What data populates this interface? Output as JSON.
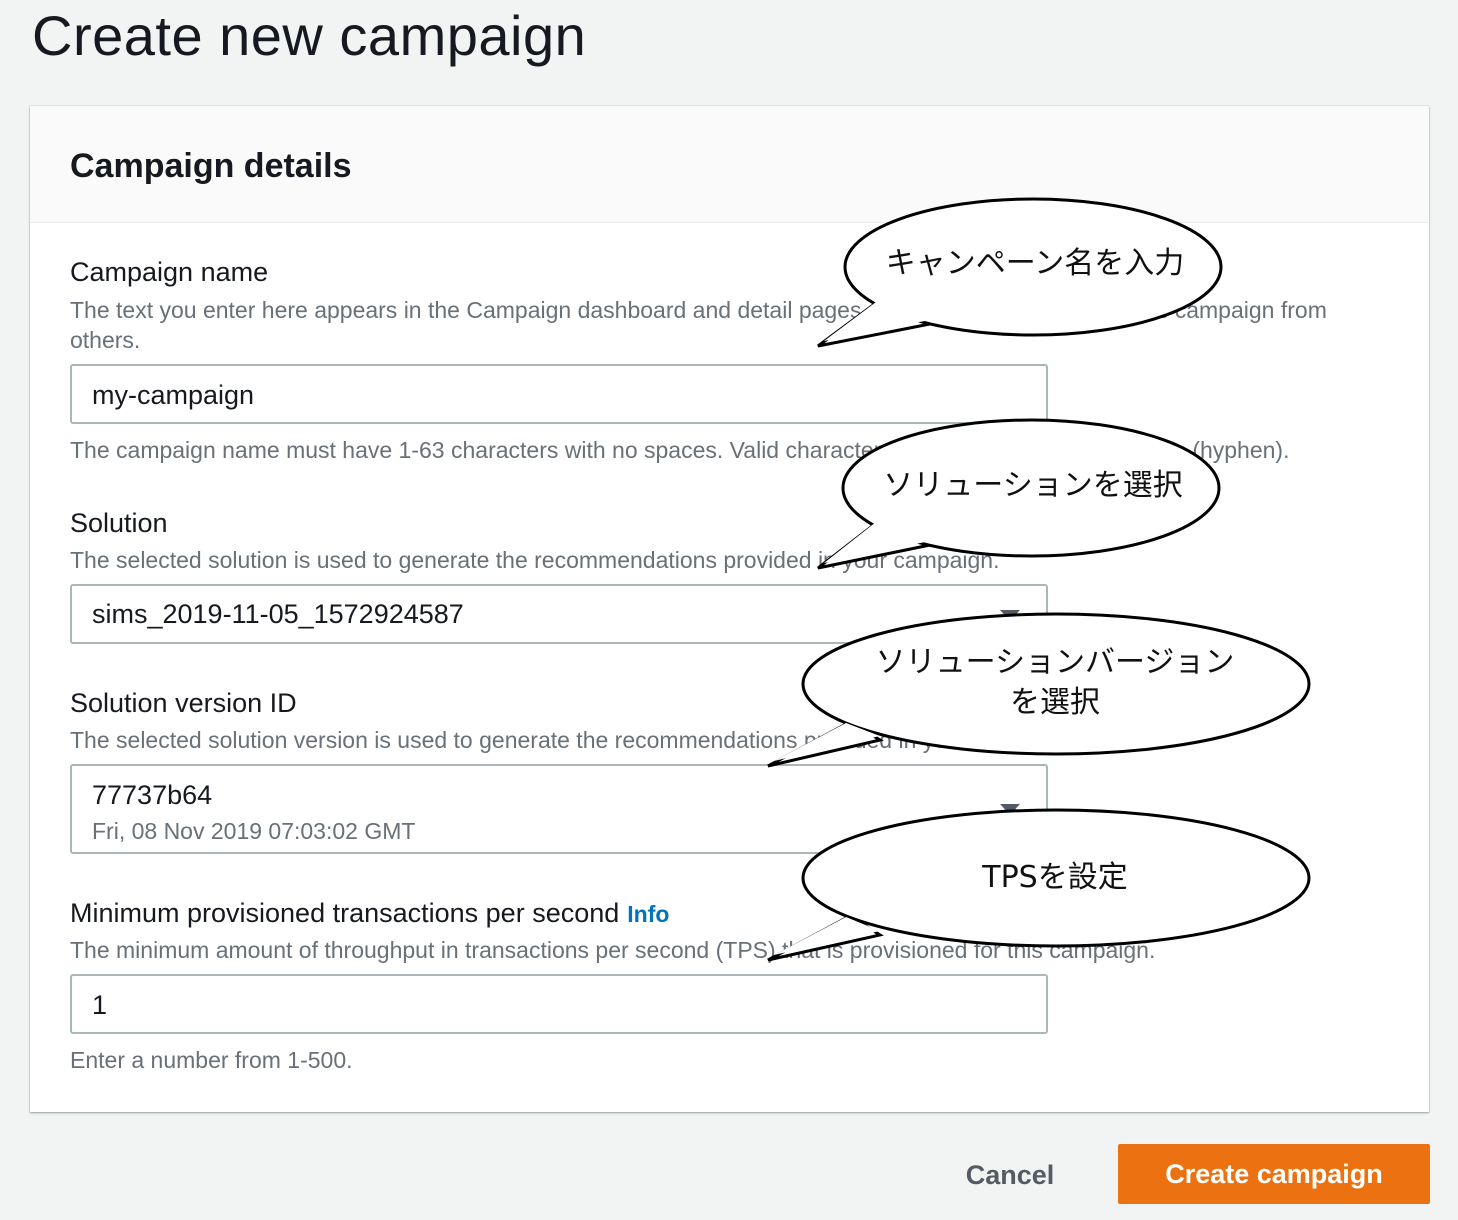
{
  "page": {
    "title": "Create new campaign"
  },
  "panel": {
    "title": "Campaign details"
  },
  "fields": {
    "campaign_name": {
      "label": "Campaign name",
      "description": "The text you enter here appears in the Campaign dashboard and detail pages and helps you distinguish this campaign from others.",
      "value": "my-campaign",
      "constraint": "The campaign name must have 1-63 characters with no spaces. Valid characters: a-z, A-Z, 0-9, and _ . @ % - (hyphen)."
    },
    "solution": {
      "label": "Solution",
      "description": "The selected solution is used to generate the recommendations provided in your campaign.",
      "selected": "sims_2019-11-05_1572924587"
    },
    "solution_version": {
      "label": "Solution version ID",
      "description": "The selected solution version is used to generate the recommendations provided in your campaign.",
      "selected": "77737b64",
      "selected_sub": "Fri, 08 Nov 2019 07:03:02 GMT"
    },
    "min_tps": {
      "label": "Minimum provisioned transactions per second",
      "info_link": "Info",
      "description": "The minimum amount of throughput in transactions per second (TPS) that is provisioned for this campaign.",
      "value": "1",
      "constraint": "Enter a number from 1-500."
    }
  },
  "actions": {
    "cancel_label": "Cancel",
    "create_label": "Create campaign"
  },
  "callouts": {
    "c1": "キャンペーン名を入力",
    "c2": "ソリューションを選択",
    "c3": "ソリューションバージョン\nを選択",
    "c4": "TPSを設定"
  },
  "colors": {
    "primary_button": "#ec7211",
    "link": "#0073bb",
    "background": "#f2f3f3"
  }
}
